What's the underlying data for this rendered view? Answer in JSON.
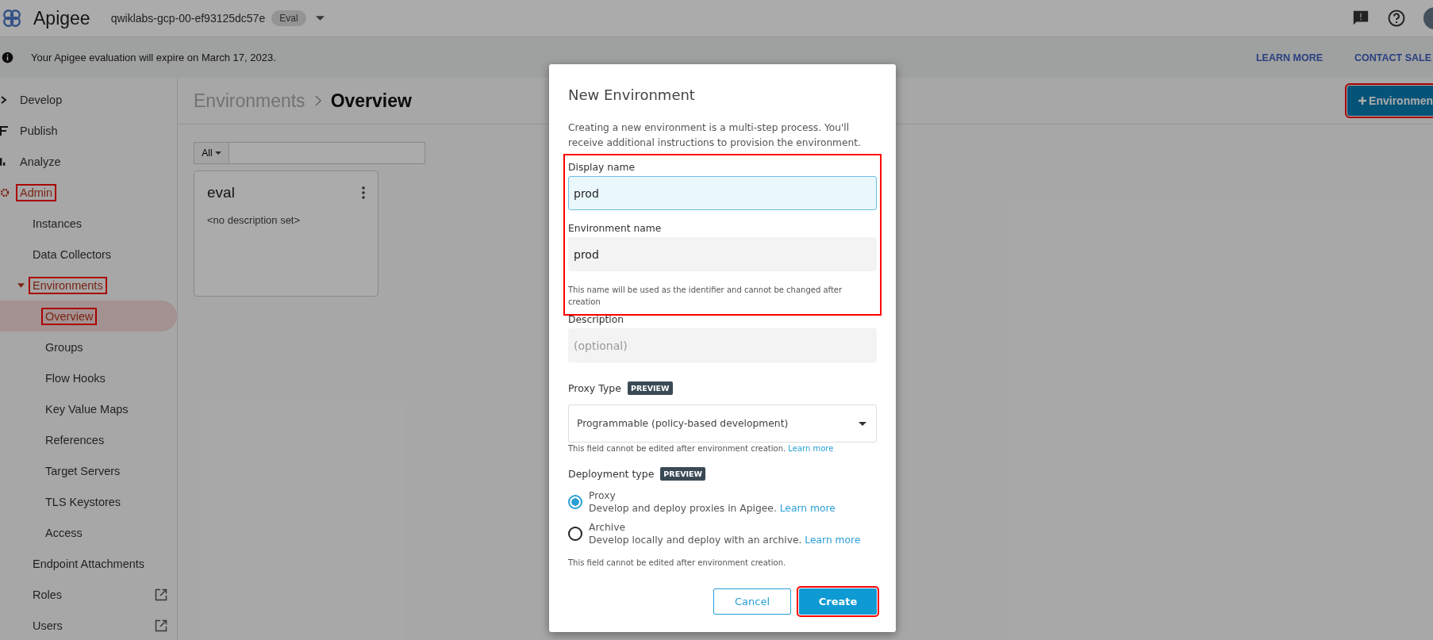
{
  "topbar": {
    "product": "Apigee",
    "org": "qwiklabs-gcp-00-ef93125dc57e",
    "badge": "Eval"
  },
  "banner": {
    "message": "Your Apigee evaluation will expire on March 17, 2023.",
    "links": [
      "LEARN MORE",
      "CONTACT SALE"
    ]
  },
  "sidebar": {
    "items": [
      {
        "label": "Develop",
        "selected": false,
        "highlighted": false
      },
      {
        "label": "Publish",
        "selected": false,
        "highlighted": false
      },
      {
        "label": "Analyze",
        "selected": false,
        "highlighted": false
      },
      {
        "label": "Admin",
        "selected": false,
        "highlighted": true,
        "children": [
          {
            "label": "Instances",
            "selected": false,
            "highlighted": false
          },
          {
            "label": "Data Collectors",
            "selected": false,
            "highlighted": false
          },
          {
            "label": "Environments",
            "selected": false,
            "highlighted": true,
            "expanded": true,
            "children": [
              {
                "label": "Overview",
                "selected": true,
                "highlighted": true
              },
              {
                "label": "Groups",
                "selected": false,
                "highlighted": false
              },
              {
                "label": "Flow Hooks",
                "selected": false,
                "highlighted": false
              },
              {
                "label": "Key Value Maps",
                "selected": false,
                "highlighted": false
              },
              {
                "label": "References",
                "selected": false,
                "highlighted": false
              },
              {
                "label": "Target Servers",
                "selected": false,
                "highlighted": false
              },
              {
                "label": "TLS Keystores",
                "selected": false,
                "highlighted": false
              },
              {
                "label": "Access",
                "selected": false,
                "highlighted": false
              }
            ]
          },
          {
            "label": "Endpoint Attachments",
            "selected": false,
            "highlighted": false
          },
          {
            "label": "Roles",
            "selected": false,
            "highlighted": false,
            "external": true
          },
          {
            "label": "Users",
            "selected": false,
            "highlighted": false,
            "external": true
          }
        ]
      }
    ]
  },
  "breadcrumb": [
    "Environments",
    "Overview"
  ],
  "add_button": {
    "label": "Environmen",
    "highlighted": true
  },
  "filter": {
    "scope": "All"
  },
  "cards": [
    {
      "name": "eval",
      "description": "<no description set>"
    }
  ],
  "dialog": {
    "title": "New Environment",
    "intro": "Creating a new environment is a multi-step process. You'll receive additional instructions to provision the environment.",
    "name_group": {
      "highlighted": true,
      "fields": [
        {
          "label": "Display name",
          "value": "prod",
          "focused": true
        },
        {
          "label": "Environment name",
          "value": "prod",
          "focused": false,
          "hint": "This name will be used as the identifier and cannot be changed after creation"
        }
      ]
    },
    "description": {
      "label": "Description",
      "placeholder": "(optional)"
    },
    "proxy_type": {
      "label": "Proxy Type",
      "badge": "PREVIEW",
      "value": "Programmable (policy-based development)",
      "hint": "This field cannot be edited after environment creation.",
      "link": "Learn more"
    },
    "deployment_type": {
      "label": "Deployment type",
      "badge": "PREVIEW",
      "hint": "This field cannot be edited after environment creation.",
      "options": [
        {
          "title": "Proxy",
          "description": "Develop and deploy proxies in Apigee.",
          "link": "Learn more",
          "selected": true
        },
        {
          "title": "Archive",
          "description": "Develop locally and deploy with an archive.",
          "link": "Learn more",
          "selected": false
        }
      ]
    },
    "buttons": [
      {
        "label": "Cancel",
        "kind": "secondary",
        "highlighted": false
      },
      {
        "label": "Create",
        "kind": "primary",
        "highlighted": true
      }
    ]
  }
}
